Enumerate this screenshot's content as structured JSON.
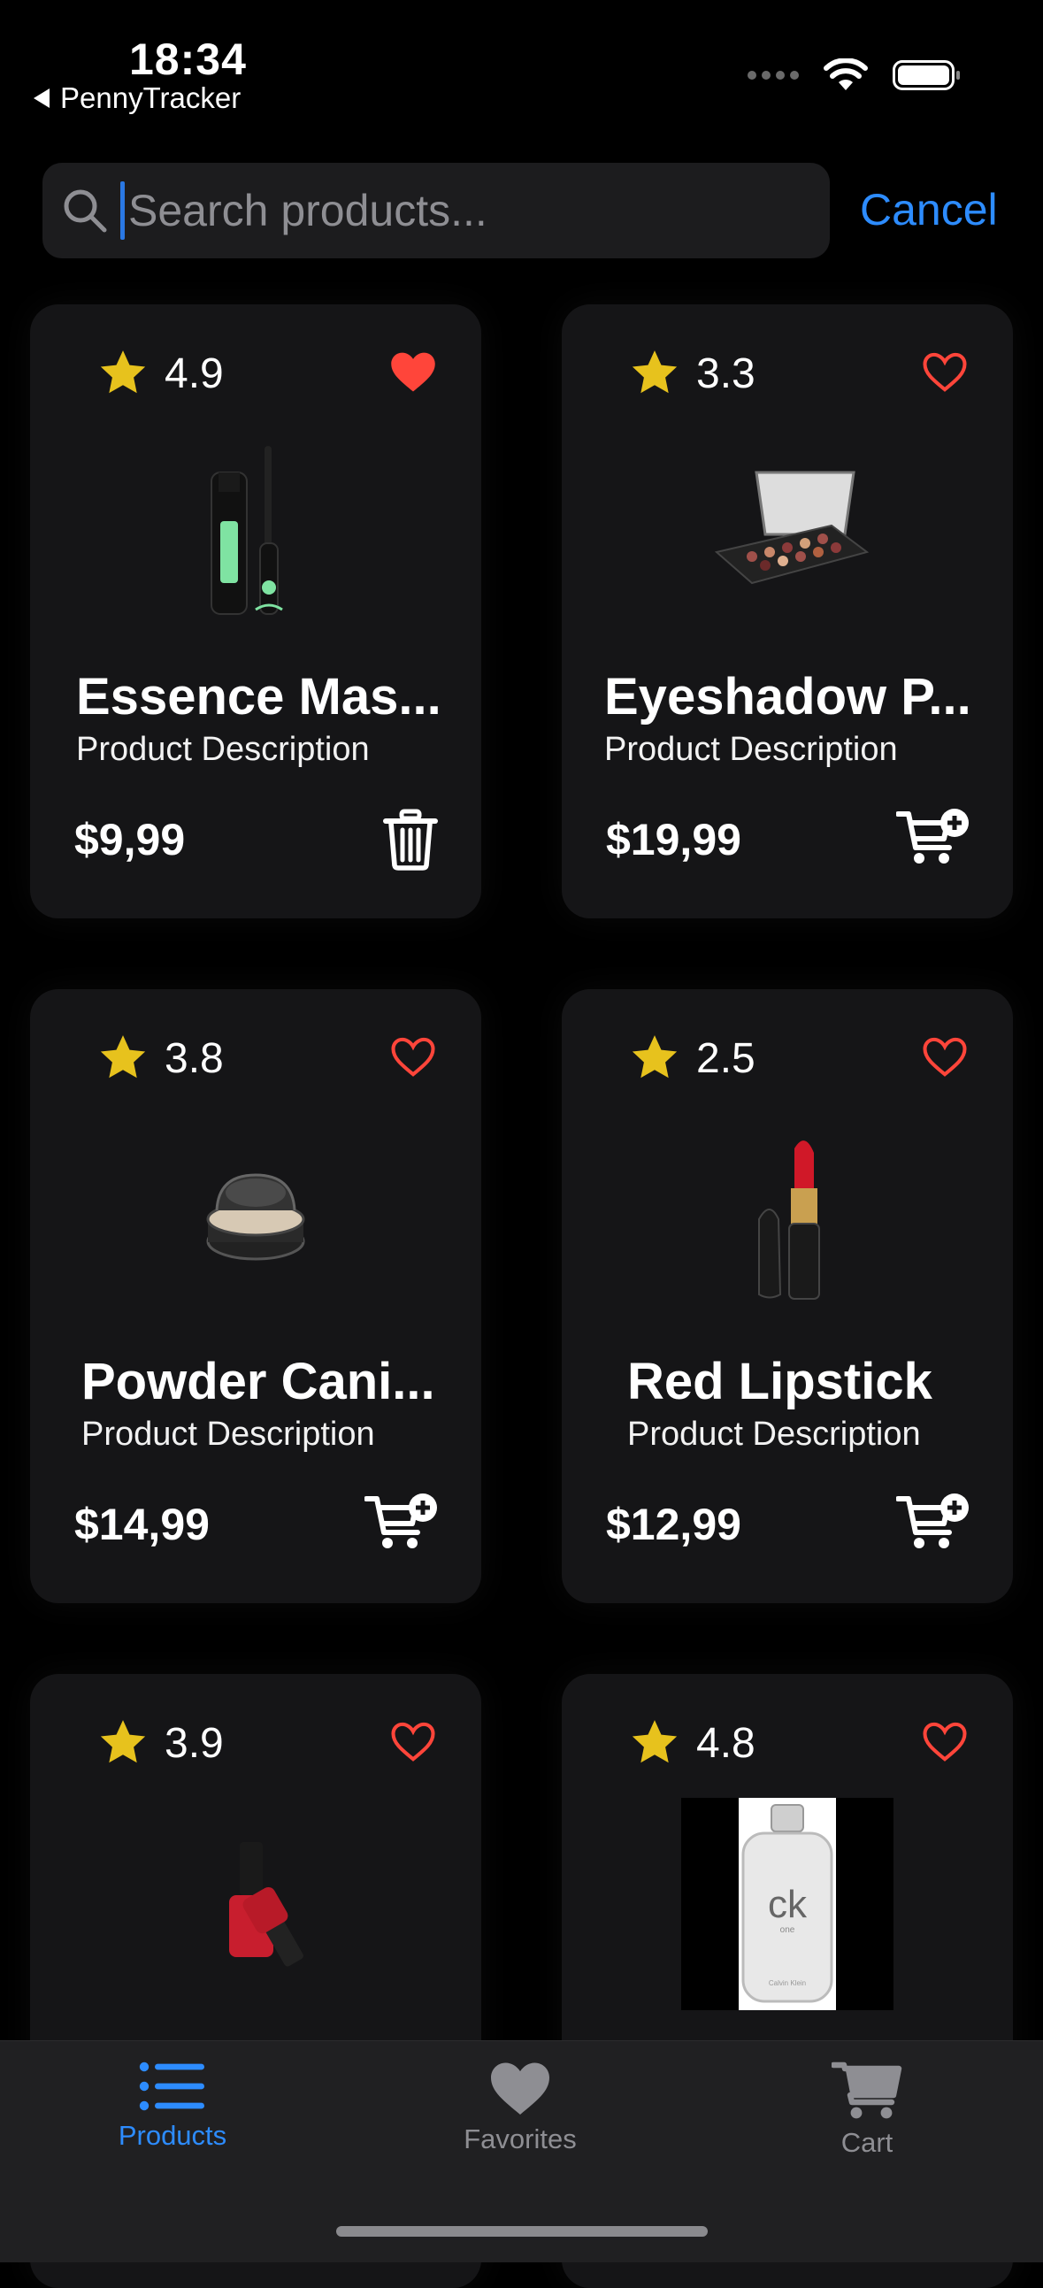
{
  "status": {
    "time": "18:34",
    "back_app": "PennyTracker"
  },
  "search": {
    "placeholder": "Search products...",
    "value": "",
    "cancel_label": "Cancel"
  },
  "products": [
    {
      "rating": "4.9",
      "favorite": true,
      "name": "Essence Mas...",
      "description": "Product Description",
      "price": "$9,99",
      "action": "delete"
    },
    {
      "rating": "3.3",
      "favorite": false,
      "name": "Eyeshadow P...",
      "description": "Product Description",
      "price": "$19,99",
      "action": "add-to-cart"
    },
    {
      "rating": "3.8",
      "favorite": false,
      "name": "Powder Cani...",
      "description": "Product Description",
      "price": "$14,99",
      "action": "add-to-cart"
    },
    {
      "rating": "2.5",
      "favorite": false,
      "name": "Red Lipstick",
      "description": "Product Description",
      "price": "$12,99",
      "action": "add-to-cart"
    },
    {
      "rating": "3.9",
      "favorite": false,
      "name": "",
      "description": "",
      "price": "",
      "action": ""
    },
    {
      "rating": "4.8",
      "favorite": false,
      "name": "",
      "description": "",
      "price": "",
      "action": ""
    }
  ],
  "perfume_brand": {
    "logo": "ck",
    "sub": "one",
    "maker": "Calvin Klein"
  },
  "tabs": [
    {
      "label": "Products",
      "icon": "list-icon",
      "active": true
    },
    {
      "label": "Favorites",
      "icon": "heart-icon",
      "active": false
    },
    {
      "label": "Cart",
      "icon": "cart-icon",
      "active": false
    }
  ],
  "colors": {
    "accent": "#2d8cff",
    "star": "#e7c21d",
    "heart": "#ff453a",
    "card": "#151517",
    "tab_inactive": "#8e8e93"
  }
}
